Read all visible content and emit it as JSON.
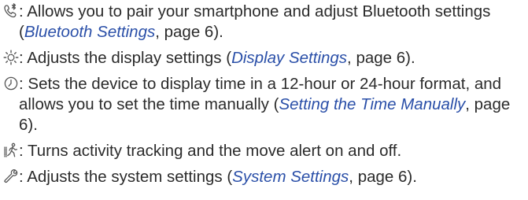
{
  "items": [
    {
      "icon": "bluetooth-phone-icon",
      "text_before": ": Allows you to pair your smartphone and adjust Bluetooth settings (",
      "link_text": "Bluetooth Settings",
      "text_after": ", page 6)."
    },
    {
      "icon": "sun-brightness-icon",
      "text_before": ": Adjusts the display settings (",
      "link_text": "Display Settings",
      "text_after": ", page 6)."
    },
    {
      "icon": "clock-icon",
      "text_before": ": Sets the device to display time in a 12-hour or 24-hour format, and allows you to set the time manually (",
      "link_text": "Setting the Time Manually",
      "text_after": ", page 6)."
    },
    {
      "icon": "walking-person-icon",
      "text": ": Turns activity tracking and the move alert on and off."
    },
    {
      "icon": "wrench-icon",
      "text_before": ": Adjusts the system settings (",
      "link_text": "System Settings",
      "text_after": ", page 6)."
    }
  ],
  "colors": {
    "text": "#2b2b2b",
    "link": "#2a4fa8"
  }
}
